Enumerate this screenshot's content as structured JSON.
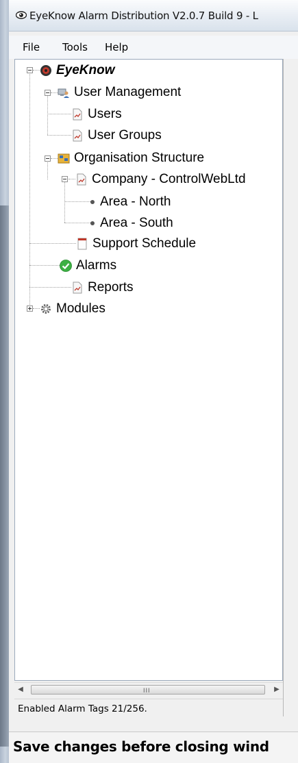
{
  "window": {
    "title": "EyeKnow Alarm Distribution V2.0.7 Build 9 - L"
  },
  "menu": {
    "items": [
      "File",
      "Tools",
      "Help"
    ]
  },
  "tree": {
    "root": "EyeKnow",
    "user_management": {
      "label": "User Management",
      "children": [
        "Users",
        "User Groups"
      ]
    },
    "organisation_structure": {
      "label": "Organisation Structure",
      "company": "Company - ControlWebLtd",
      "areas": [
        "Area - North",
        "Area - South"
      ]
    },
    "support_schedule": "Support Schedule",
    "alarms": "Alarms",
    "reports": "Reports",
    "modules": "Modules"
  },
  "statusbar": {
    "text": "Enabled Alarm Tags 21/256."
  },
  "banner": {
    "text": "Save changes before closing wind"
  },
  "scrollbar": {
    "grip": "III",
    "left_arrow": "◀",
    "right_arrow": "▶"
  },
  "colors": {
    "check_green": "#3cb043",
    "page_red": "#c0392b",
    "folder_yellow": "#e8b33a",
    "tree_line": "#a0a0a0"
  },
  "icons": {
    "root": "eyeknow-logo-icon",
    "user_management": "users-computer-icon",
    "document": "document-icon",
    "organisation": "org-chart-icon",
    "support_schedule": "calendar-icon",
    "alarms": "green-check-icon",
    "modules": "gear-icon",
    "bullet": "bullet-icon"
  }
}
